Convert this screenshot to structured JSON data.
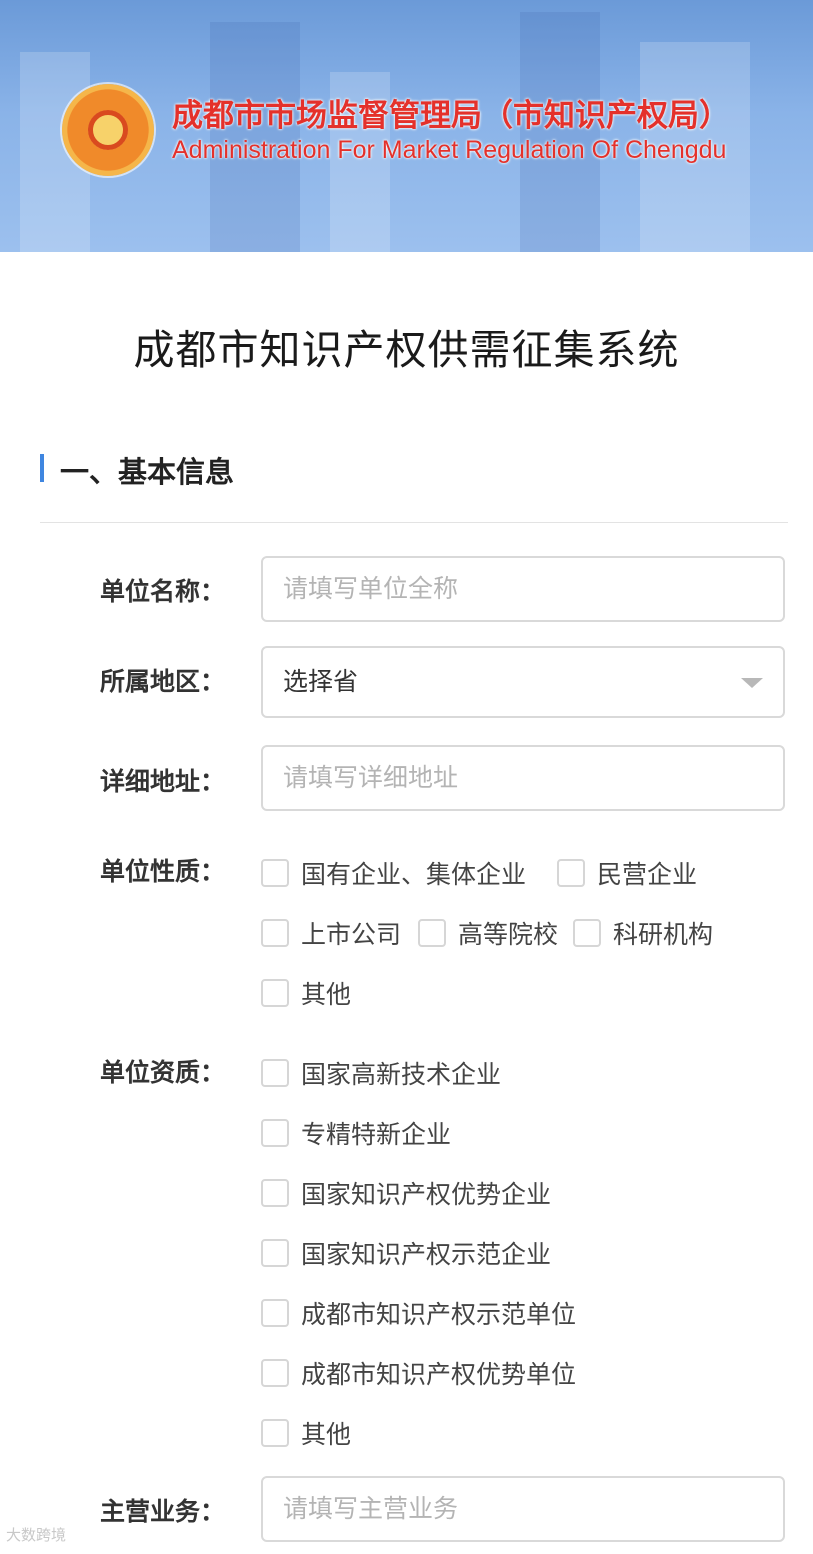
{
  "header": {
    "org_name_cn": "成都市市场监督管理局（市知识产权局）",
    "org_name_en": "Administration For Market Regulation Of Chengdu",
    "logo_icon": "emblem-logo-icon",
    "brand_color": "#e4312b",
    "banner_color": "#7aa6e2"
  },
  "page": {
    "title": "成都市知识产权供需征集系统"
  },
  "section": {
    "title": "一、基本信息",
    "accent": "#3f86e0"
  },
  "form": {
    "unit_name": {
      "label": "单位名称：",
      "placeholder": "请填写单位全称"
    },
    "region": {
      "label": "所属地区：",
      "selected": "选择省"
    },
    "address": {
      "label": "详细地址：",
      "placeholder": "请填写详细地址"
    },
    "unit_nature": {
      "label": "单位性质：",
      "options": [
        "国有企业、集体企业",
        "民营企业",
        "上市公司",
        "高等院校",
        "科研机构",
        "其他"
      ]
    },
    "unit_qualification": {
      "label": "单位资质：",
      "options": [
        "国家高新技术企业",
        "专精特新企业",
        "国家知识产权优势企业",
        "国家知识产权示范企业",
        "成都市知识产权示范单位",
        "成都市知识产权优势单位",
        "其他"
      ]
    },
    "main_business": {
      "label": "主营业务：",
      "placeholder": "请填写主营业务"
    }
  },
  "watermark": "大数跨境"
}
